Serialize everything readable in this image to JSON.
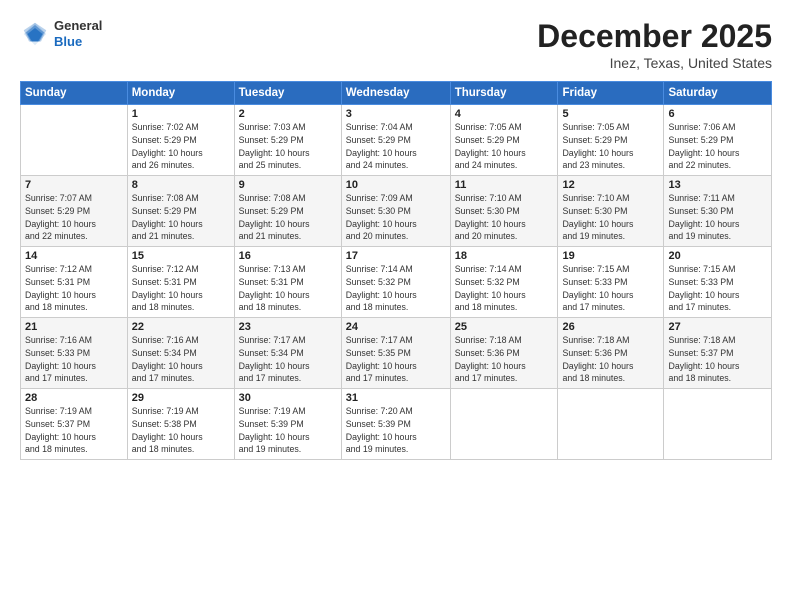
{
  "header": {
    "logo_general": "General",
    "logo_blue": "Blue",
    "month": "December 2025",
    "location": "Inez, Texas, United States"
  },
  "weekdays": [
    "Sunday",
    "Monday",
    "Tuesday",
    "Wednesday",
    "Thursday",
    "Friday",
    "Saturday"
  ],
  "weeks": [
    [
      {
        "day": "",
        "info": ""
      },
      {
        "day": "1",
        "info": "Sunrise: 7:02 AM\nSunset: 5:29 PM\nDaylight: 10 hours\nand 26 minutes."
      },
      {
        "day": "2",
        "info": "Sunrise: 7:03 AM\nSunset: 5:29 PM\nDaylight: 10 hours\nand 25 minutes."
      },
      {
        "day": "3",
        "info": "Sunrise: 7:04 AM\nSunset: 5:29 PM\nDaylight: 10 hours\nand 24 minutes."
      },
      {
        "day": "4",
        "info": "Sunrise: 7:05 AM\nSunset: 5:29 PM\nDaylight: 10 hours\nand 24 minutes."
      },
      {
        "day": "5",
        "info": "Sunrise: 7:05 AM\nSunset: 5:29 PM\nDaylight: 10 hours\nand 23 minutes."
      },
      {
        "day": "6",
        "info": "Sunrise: 7:06 AM\nSunset: 5:29 PM\nDaylight: 10 hours\nand 22 minutes."
      }
    ],
    [
      {
        "day": "7",
        "info": "Sunrise: 7:07 AM\nSunset: 5:29 PM\nDaylight: 10 hours\nand 22 minutes."
      },
      {
        "day": "8",
        "info": "Sunrise: 7:08 AM\nSunset: 5:29 PM\nDaylight: 10 hours\nand 21 minutes."
      },
      {
        "day": "9",
        "info": "Sunrise: 7:08 AM\nSunset: 5:29 PM\nDaylight: 10 hours\nand 21 minutes."
      },
      {
        "day": "10",
        "info": "Sunrise: 7:09 AM\nSunset: 5:30 PM\nDaylight: 10 hours\nand 20 minutes."
      },
      {
        "day": "11",
        "info": "Sunrise: 7:10 AM\nSunset: 5:30 PM\nDaylight: 10 hours\nand 20 minutes."
      },
      {
        "day": "12",
        "info": "Sunrise: 7:10 AM\nSunset: 5:30 PM\nDaylight: 10 hours\nand 19 minutes."
      },
      {
        "day": "13",
        "info": "Sunrise: 7:11 AM\nSunset: 5:30 PM\nDaylight: 10 hours\nand 19 minutes."
      }
    ],
    [
      {
        "day": "14",
        "info": "Sunrise: 7:12 AM\nSunset: 5:31 PM\nDaylight: 10 hours\nand 18 minutes."
      },
      {
        "day": "15",
        "info": "Sunrise: 7:12 AM\nSunset: 5:31 PM\nDaylight: 10 hours\nand 18 minutes."
      },
      {
        "day": "16",
        "info": "Sunrise: 7:13 AM\nSunset: 5:31 PM\nDaylight: 10 hours\nand 18 minutes."
      },
      {
        "day": "17",
        "info": "Sunrise: 7:14 AM\nSunset: 5:32 PM\nDaylight: 10 hours\nand 18 minutes."
      },
      {
        "day": "18",
        "info": "Sunrise: 7:14 AM\nSunset: 5:32 PM\nDaylight: 10 hours\nand 18 minutes."
      },
      {
        "day": "19",
        "info": "Sunrise: 7:15 AM\nSunset: 5:33 PM\nDaylight: 10 hours\nand 17 minutes."
      },
      {
        "day": "20",
        "info": "Sunrise: 7:15 AM\nSunset: 5:33 PM\nDaylight: 10 hours\nand 17 minutes."
      }
    ],
    [
      {
        "day": "21",
        "info": "Sunrise: 7:16 AM\nSunset: 5:33 PM\nDaylight: 10 hours\nand 17 minutes."
      },
      {
        "day": "22",
        "info": "Sunrise: 7:16 AM\nSunset: 5:34 PM\nDaylight: 10 hours\nand 17 minutes."
      },
      {
        "day": "23",
        "info": "Sunrise: 7:17 AM\nSunset: 5:34 PM\nDaylight: 10 hours\nand 17 minutes."
      },
      {
        "day": "24",
        "info": "Sunrise: 7:17 AM\nSunset: 5:35 PM\nDaylight: 10 hours\nand 17 minutes."
      },
      {
        "day": "25",
        "info": "Sunrise: 7:18 AM\nSunset: 5:36 PM\nDaylight: 10 hours\nand 17 minutes."
      },
      {
        "day": "26",
        "info": "Sunrise: 7:18 AM\nSunset: 5:36 PM\nDaylight: 10 hours\nand 18 minutes."
      },
      {
        "day": "27",
        "info": "Sunrise: 7:18 AM\nSunset: 5:37 PM\nDaylight: 10 hours\nand 18 minutes."
      }
    ],
    [
      {
        "day": "28",
        "info": "Sunrise: 7:19 AM\nSunset: 5:37 PM\nDaylight: 10 hours\nand 18 minutes."
      },
      {
        "day": "29",
        "info": "Sunrise: 7:19 AM\nSunset: 5:38 PM\nDaylight: 10 hours\nand 18 minutes."
      },
      {
        "day": "30",
        "info": "Sunrise: 7:19 AM\nSunset: 5:39 PM\nDaylight: 10 hours\nand 19 minutes."
      },
      {
        "day": "31",
        "info": "Sunrise: 7:20 AM\nSunset: 5:39 PM\nDaylight: 10 hours\nand 19 minutes."
      },
      {
        "day": "",
        "info": ""
      },
      {
        "day": "",
        "info": ""
      },
      {
        "day": "",
        "info": ""
      }
    ]
  ]
}
